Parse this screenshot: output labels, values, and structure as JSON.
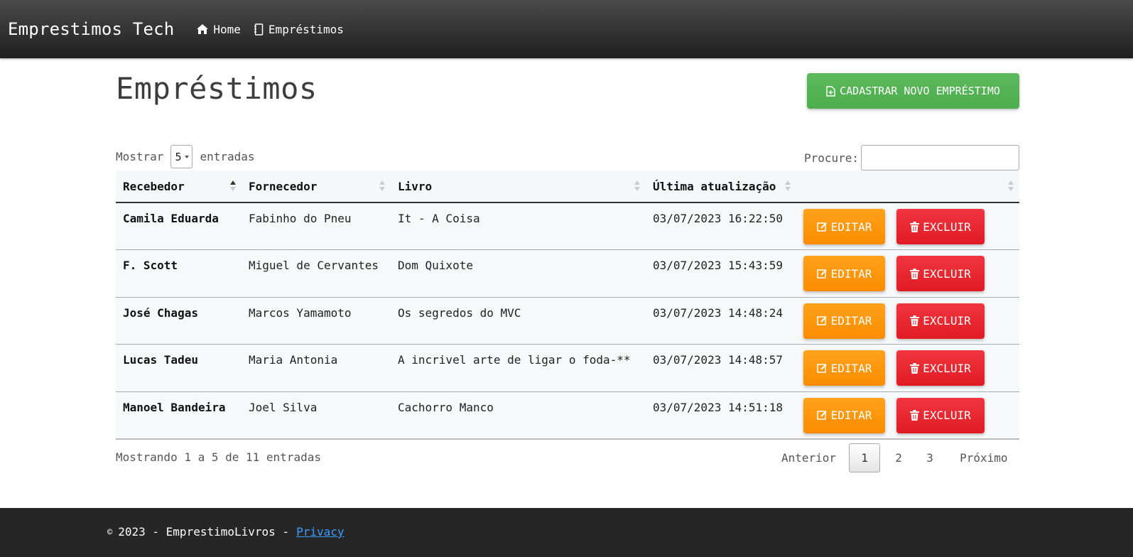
{
  "navbar": {
    "brand": "Emprestimos Tech",
    "links": [
      {
        "label": "Home",
        "icon": "home-icon"
      },
      {
        "label": "Empréstimos",
        "icon": "book-icon"
      }
    ]
  },
  "main": {
    "title": "Empréstimos",
    "new_button_label": "CADASTRAR NOVO EMPRÉSTIMO",
    "length": {
      "prefix": "Mostrar",
      "value": "5",
      "suffix": "entradas"
    },
    "search": {
      "label": "Procure:",
      "value": ""
    }
  },
  "table": {
    "columns": [
      "Recebedor",
      "Fornecedor",
      "Livro",
      "Última atualização",
      ""
    ],
    "sorted_column": "Recebedor",
    "rows": [
      {
        "recebedor": "Camila Eduarda",
        "fornecedor": "Fabinho do Pneu",
        "livro": "It - A Coisa",
        "atualizacao": "03/07/2023 16:22:50"
      },
      {
        "recebedor": "F. Scott",
        "fornecedor": "Miguel de Cervantes",
        "livro": "Dom Quixote",
        "atualizacao": "03/07/2023 15:43:59"
      },
      {
        "recebedor": "José Chagas",
        "fornecedor": "Marcos Yamamoto",
        "livro": "Os segredos do MVC",
        "atualizacao": "03/07/2023 14:48:24"
      },
      {
        "recebedor": "Lucas Tadeu",
        "fornecedor": "Maria Antonia",
        "livro": "A incrivel arte de ligar o foda-**",
        "atualizacao": "03/07/2023 14:48:57"
      },
      {
        "recebedor": "Manoel Bandeira",
        "fornecedor": "Joel Silva",
        "livro": "Cachorro Manco",
        "atualizacao": "03/07/2023 14:51:18"
      }
    ],
    "edit_label": "EDITAR",
    "delete_label": "EXCLUIR"
  },
  "info": "Mostrando 1 a 5 de 11 entradas",
  "pagination": {
    "prev": "Anterior",
    "pages": [
      "1",
      "2",
      "3"
    ],
    "current": "1",
    "next": "Próximo"
  },
  "footer": {
    "copy_symbol": "©",
    "text": "2023 - EmprestimoLivros -",
    "privacy_label": "Privacy"
  },
  "colors": {
    "success": "#5cb85c",
    "warning": "#fb8c00",
    "danger": "#e01b24",
    "navbar": "#2b2b2b",
    "footer": "#262626",
    "link": "#3b9cff"
  }
}
